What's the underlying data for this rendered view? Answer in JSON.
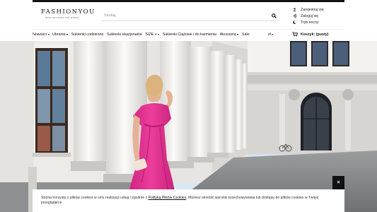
{
  "brand": {
    "name": "FASHIONYOU",
    "tagline": "MODA DESIGNED FOR WOMEN"
  },
  "search": {
    "placeholder": "Szukaj"
  },
  "account": {
    "register": "Zarejestruj się",
    "login": "Zaloguj się",
    "night_mode": "Tryb nocny"
  },
  "nav": {
    "items": [
      {
        "label": "Nowości",
        "dropdown": true
      },
      {
        "label": "Ubrania",
        "dropdown": true
      },
      {
        "label": "Sukienki codzienne",
        "dropdown": false
      },
      {
        "label": "Sukienki okazjonalne",
        "dropdown": false
      },
      {
        "label": "SIZE +",
        "dropdown": true
      },
      {
        "label": "Sukienki Ciążowe i do karmienia",
        "dropdown": false
      },
      {
        "label": "Akcesoria",
        "dropdown": true
      },
      {
        "label": "Sale",
        "dropdown": false
      }
    ],
    "language": "zł",
    "cart": "Koszyk: (pusty)"
  },
  "cookie": {
    "text_before": "Strona korzysta z plików cookies w celu realizacji usług i zgodnie z ",
    "link": "Polityką Plików Cookies",
    "text_after": ". Możesz określić warunki przechowywania lub dostępu do plików cookies w Twojej przeglądarce.",
    "close": "×"
  },
  "colors": {
    "accent": "#111111",
    "dress": "#e0338f",
    "sky": "#9ec1dc"
  },
  "icons": [
    "search-icon",
    "user-icon",
    "login-icon",
    "moon-icon",
    "cart-icon"
  ]
}
